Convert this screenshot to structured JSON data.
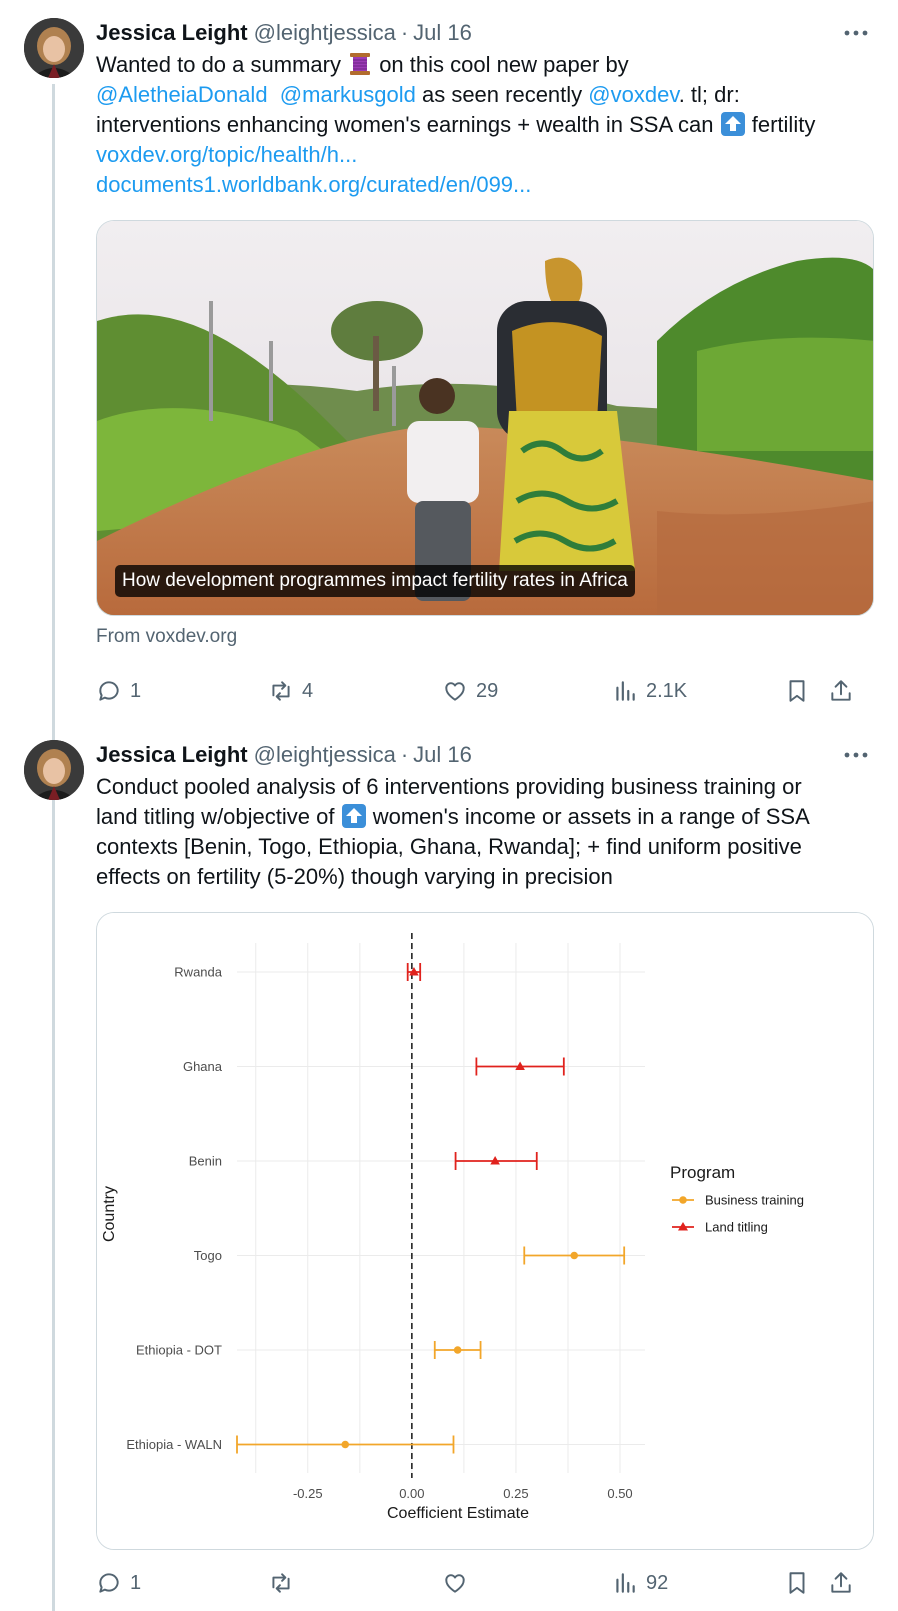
{
  "tweets": [
    {
      "author_name": "Jessica Leight",
      "handle": "@leightjessica",
      "separator": "·",
      "date": "Jul 16",
      "text": {
        "line1a": "Wanted to do a summary ",
        "line1b": " on this cool new paper by",
        "mention1": "@AletheiaDonald",
        "mention2": "@markusgold",
        "line2mid": " as seen recently ",
        "mention3": "@voxdev",
        "line2end": ".  tl; dr:",
        "line3a": "interventions enhancing women's earnings + wealth in SSA can ",
        "line3b": " fertility",
        "link1": "voxdev.org/topic/health/h...",
        "link2": "documents1.worldbank.org/curated/en/099..."
      },
      "card": {
        "caption": "How development programmes impact fertility rates in Africa",
        "from": "From voxdev.org"
      },
      "stats": {
        "replies": "1",
        "reposts": "4",
        "likes": "29",
        "views": "2.1K"
      }
    },
    {
      "author_name": "Jessica Leight",
      "handle": "@leightjessica",
      "separator": "·",
      "date": "Jul 16",
      "text": {
        "line1": "Conduct pooled analysis of 6 interventions providing business training or",
        "line2a": "land titling w/objective of ",
        "line2b": " women's income or assets in a range of SSA",
        "line3": "contexts [Benin, Togo, Ethiopia, Ghana, Rwanda]; + find uniform positive",
        "line4": "effects on fertility  (5-20%) though varying in precision"
      },
      "stats": {
        "replies": "1",
        "reposts": "",
        "likes": "",
        "views": "92"
      }
    }
  ],
  "icons": [
    "more-icon",
    "reply-icon",
    "repost-icon",
    "like-icon",
    "views-icon",
    "bookmark-icon",
    "share-icon",
    "thread-emoji-icon",
    "up-arrow-emoji-icon"
  ],
  "colors": {
    "link": "#1d9bf0",
    "muted": "#536471",
    "business": "#f2a62a",
    "land": "#e0221d"
  },
  "chart_data": {
    "type": "scatter",
    "subtype": "forest-plot",
    "ylabel": "Country",
    "xlabel": "Coefficient Estimate",
    "xlim": [
      -0.42,
      0.56
    ],
    "xticks": [
      -0.25,
      0.0,
      0.25,
      0.5
    ],
    "xtick_labels": [
      "-0.25",
      "0.00",
      "0.25",
      "0.50"
    ],
    "reference_line": 0,
    "grid": true,
    "legend": {
      "title": "Program",
      "placement": "right",
      "entries": [
        "Business training",
        "Land titling"
      ]
    },
    "series": [
      {
        "name": "Business training",
        "marker": "circle",
        "color": "#f2a62a",
        "points": [
          {
            "country": "Togo",
            "estimate": 0.39,
            "low": 0.27,
            "high": 0.51
          },
          {
            "country": "Ethiopia - DOT",
            "estimate": 0.11,
            "low": 0.055,
            "high": 0.165
          },
          {
            "country": "Ethiopia - WALN",
            "estimate": -0.16,
            "low": -0.42,
            "high": 0.1
          }
        ]
      },
      {
        "name": "Land titling",
        "marker": "triangle",
        "color": "#e0221d",
        "points": [
          {
            "country": "Rwanda",
            "estimate": 0.005,
            "low": -0.01,
            "high": 0.02
          },
          {
            "country": "Ghana",
            "estimate": 0.26,
            "low": 0.155,
            "high": 0.365
          },
          {
            "country": "Benin",
            "estimate": 0.2,
            "low": 0.105,
            "high": 0.3
          }
        ]
      }
    ],
    "categories": [
      "Rwanda",
      "Ghana",
      "Benin",
      "Togo",
      "Ethiopia - DOT",
      "Ethiopia - WALN"
    ]
  }
}
